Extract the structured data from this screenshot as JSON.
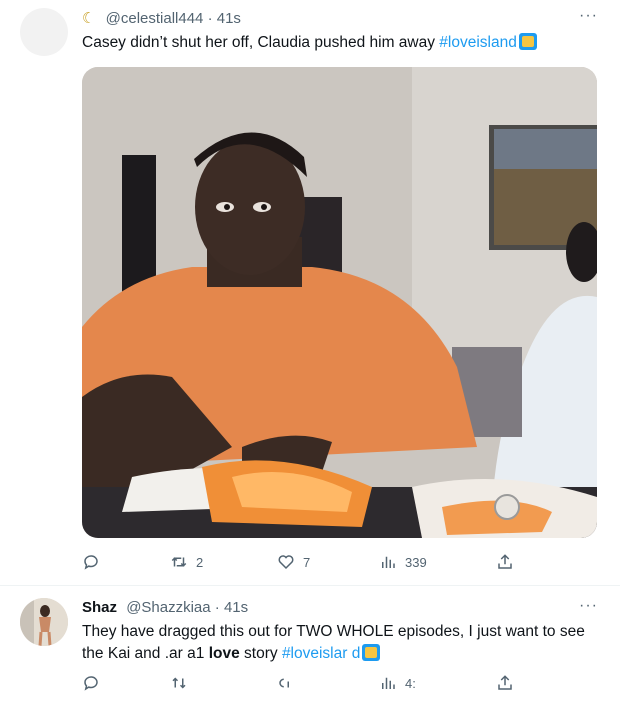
{
  "tweets": [
    {
      "handle": "@celestiall444",
      "separator": "·",
      "time": "41s",
      "more": "···",
      "text_before": "Casey didn’t shut her off, Claudia pushed him away",
      "hashtag": "#loveisland",
      "actions": {
        "replies": "",
        "retweets": "2",
        "likes": "7",
        "views": "339"
      }
    },
    {
      "name": "Shaz",
      "handle": "@Shazzkiaa",
      "separator": "·",
      "time": "41s",
      "more": "···",
      "text_before": "They have dragged this out for TWO WHOLE episodes, I just want to see the Kai and",
      "text_middle": ".ar a1",
      "text_bold": "love",
      "text_after": "story",
      "hashtag": "#loveislar d",
      "actions": {
        "replies": "",
        "retweets": "",
        "likes": "",
        "views": "4:"
      }
    }
  ],
  "icons": {
    "moon": "crescent-moon-icon",
    "reply": "reply-icon",
    "retweet": "retweet-icon",
    "like": "heart-icon",
    "views": "views-icon",
    "share": "share-icon"
  },
  "colors": {
    "link": "#1d9bf0",
    "secondary_text": "#536471",
    "primary_text": "#0f1419"
  }
}
